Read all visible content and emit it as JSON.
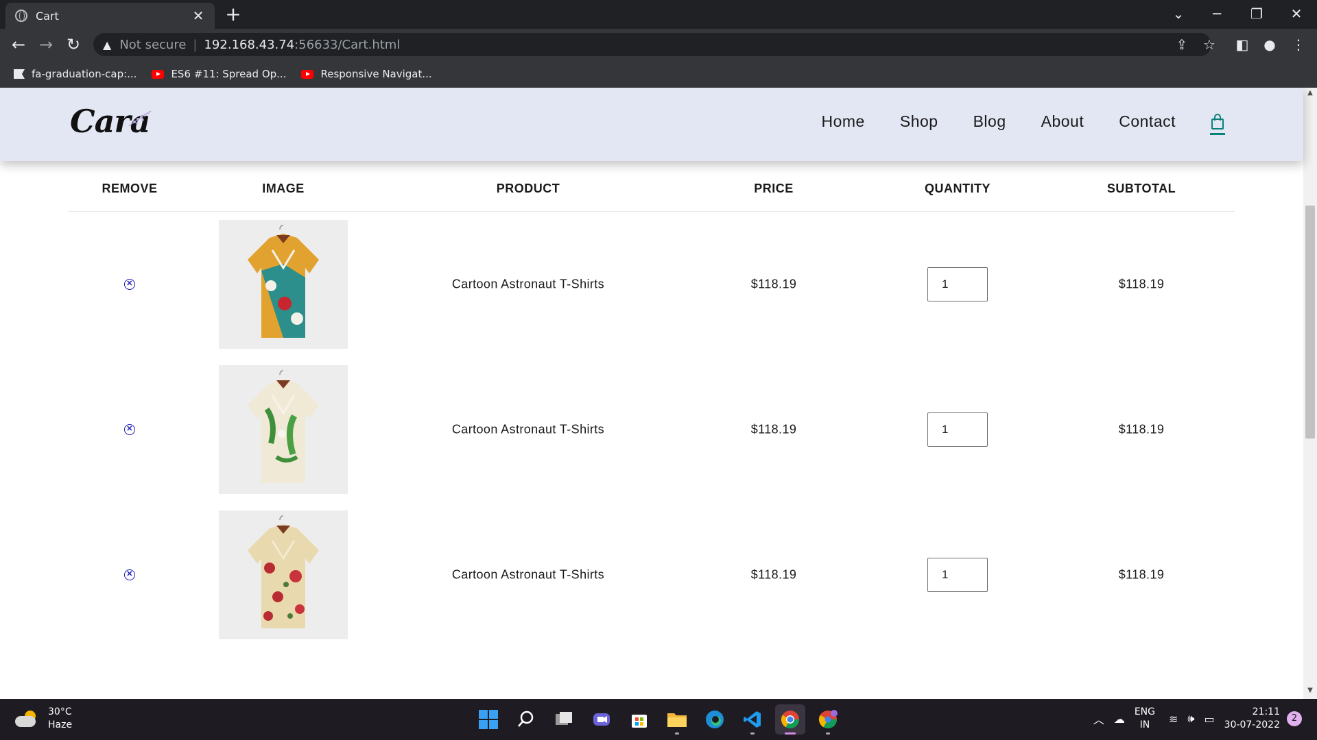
{
  "browser": {
    "tab_title": "Cart",
    "tab_close": "✕",
    "new_tab": "+",
    "security_label": "Not secure",
    "url_host": "192.168.43.74",
    "url_rest": ":56633/Cart.html",
    "bookmarks": [
      {
        "label": "fa-graduation-cap:...",
        "icon": "flag-icon"
      },
      {
        "label": "ES6 #11: Spread Op...",
        "icon": "youtube-icon"
      },
      {
        "label": "Responsive Navigat...",
        "icon": "youtube-icon"
      }
    ]
  },
  "site": {
    "logo": "Cara",
    "nav": [
      "Home",
      "Shop",
      "Blog",
      "About",
      "Contact"
    ],
    "accent_color": "#088178"
  },
  "cart": {
    "headers": [
      "REMOVE",
      "IMAGE",
      "PRODUCT",
      "PRICE",
      "QUANTITY",
      "SUBTOTAL"
    ],
    "rows": [
      {
        "product": "Cartoon Astronaut T-Shirts",
        "price": "$118.19",
        "quantity": "1",
        "subtotal": "$118.19",
        "image": "shirt-yellow-teal-print"
      },
      {
        "product": "Cartoon Astronaut T-Shirts",
        "price": "$118.19",
        "quantity": "1",
        "subtotal": "$118.19",
        "image": "shirt-cream-leaf-print"
      },
      {
        "product": "Cartoon Astronaut T-Shirts",
        "price": "$118.19",
        "quantity": "1",
        "subtotal": "$118.19",
        "image": "shirt-red-floral-print"
      }
    ]
  },
  "taskbar": {
    "temperature": "30°C",
    "condition": "Haze",
    "lang_top": "ENG",
    "lang_bottom": "IN",
    "time": "21:11",
    "date": "30-07-2022",
    "notifications": "2"
  }
}
